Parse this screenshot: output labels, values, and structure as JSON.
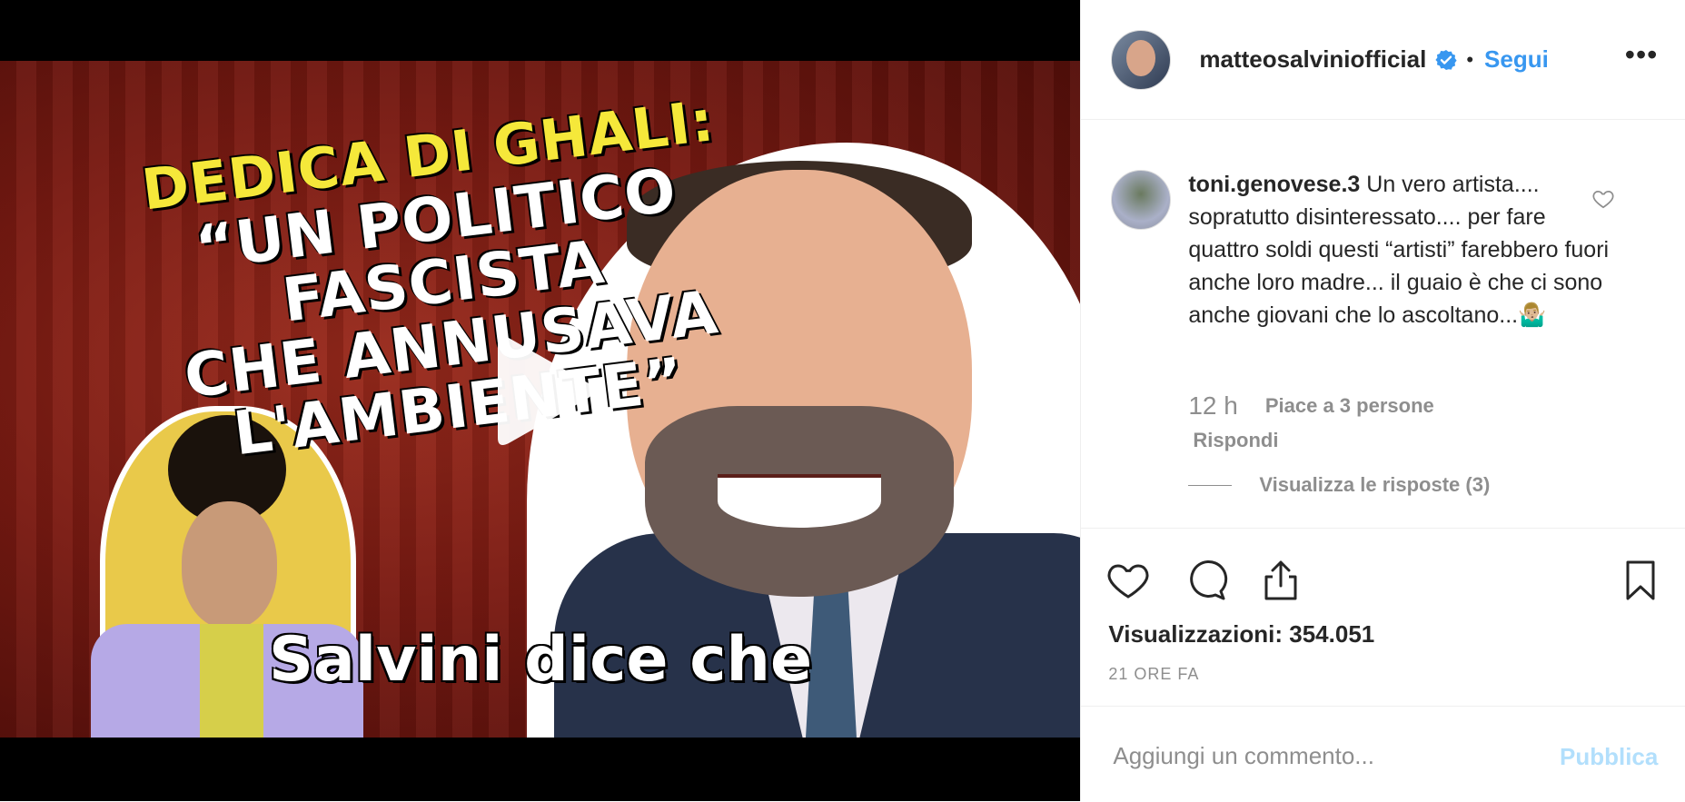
{
  "video": {
    "headline_line1": "DEDICA DI GHALI:",
    "headline_line2": "“UN POLITICO FASCISTA",
    "headline_line3": "CHE ANNUSAVA L'AMBIENTE”",
    "caption": "Salvini dice che",
    "play_icon": "play-icon"
  },
  "header": {
    "username": "matteosalviniofficial",
    "verified_icon": "verified-badge-icon",
    "separator": "•",
    "follow_label": "Segui",
    "more_label": "•••"
  },
  "comment": {
    "username": "toni.genovese.3",
    "text": "Un vero artista.... sopratutto disinteressato.... per fare quattro soldi questi “artisti” farebbero fuori anche loro madre... il guaio è che ci sono anche giovani che lo ascoltano...🤷🏼‍♂️",
    "time": "12 h",
    "likes": "Piace a 3 persone",
    "reply_label": "Rispondi",
    "view_replies": "Visualizza le risposte (3)"
  },
  "actions": {
    "like_icon": "heart-icon",
    "comment_icon": "comment-icon",
    "share_icon": "share-icon",
    "save_icon": "bookmark-icon"
  },
  "stats": {
    "views": "Visualizzazioni: 354.051",
    "age": "21 ORE FA"
  },
  "add_comment": {
    "placeholder": "Aggiungi un commento...",
    "publish_label": "Pubblica"
  },
  "colors": {
    "accent": "#3897f0",
    "muted": "#8e8e8e",
    "publish_disabled": "#b2dffc"
  }
}
